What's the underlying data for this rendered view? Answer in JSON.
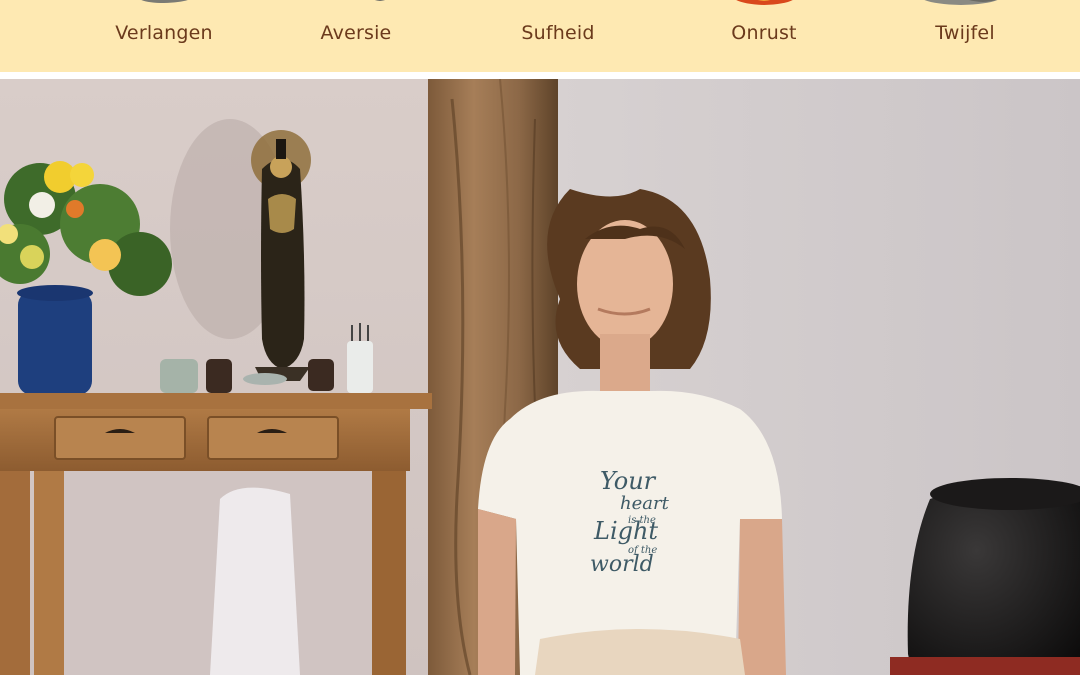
{
  "hindrances": {
    "items": [
      {
        "label": "Verlangen",
        "icon": "stone-icon",
        "icon_color": "#7a7a74"
      },
      {
        "label": "Aversie",
        "icon": "stone-icon",
        "icon_color": "#7a7a74"
      },
      {
        "label": "Sufheid",
        "icon": "stone-icon",
        "icon_color": "#7a7a74"
      },
      {
        "label": "Onrust",
        "icon": "fire-icon",
        "icon_color": "#d9481c"
      },
      {
        "label": "Twijfel",
        "icon": "stone-icon",
        "icon_color": "#7a7a74"
      }
    ],
    "background": "#fee9b2",
    "text_color": "#6b3a1c"
  },
  "photo": {
    "alt": "Vrouw mediteert met gesloten ogen",
    "shirt_lines": [
      "Your",
      "heart",
      "is the",
      "Light",
      "of the",
      "world"
    ]
  }
}
